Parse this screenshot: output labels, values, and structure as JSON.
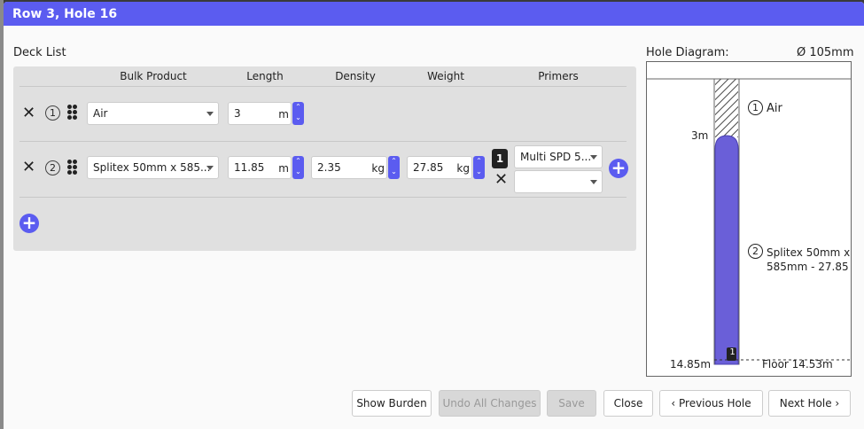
{
  "dialog": {
    "title": "Row 3, Hole 16"
  },
  "deck_list": {
    "title": "Deck List",
    "columns": {
      "bulk_product": "Bulk Product",
      "length": "Length",
      "density": "Density",
      "weight": "Weight",
      "primers": "Primers"
    },
    "rows": [
      {
        "index": "1",
        "product": "Air",
        "length": "3",
        "length_unit": "m"
      },
      {
        "index": "2",
        "product": "Splitex 50mm x 585...",
        "length": "11.85",
        "length_unit": "m",
        "density": "2.35",
        "density_unit": "kg",
        "weight": "27.85",
        "weight_unit": "kg",
        "primer_count": "1",
        "primer_1": "Multi SPD 5...",
        "primer_2": ""
      }
    ]
  },
  "hole_diagram": {
    "title": "Hole Diagram:",
    "diameter": "Ø 105mm",
    "air_label_num": "1",
    "air_label": "Air",
    "depth_top": "3m",
    "product_label_num": "2",
    "product_label_line1": "Splitex 50mm x",
    "product_label_line2": "585mm - 27.85",
    "primer_marker": "1",
    "depth_bottom": "14.85m",
    "floor": "Floor 14.53m",
    "colors": {
      "product": "#6a5fd8",
      "accent": "#5b5cf0"
    }
  },
  "footer": {
    "show_burden": "Show Burden",
    "undo_all": "Undo All Changes",
    "save": "Save",
    "close": "Close",
    "previous_hole": "Previous Hole",
    "next_hole": "Next Hole"
  }
}
